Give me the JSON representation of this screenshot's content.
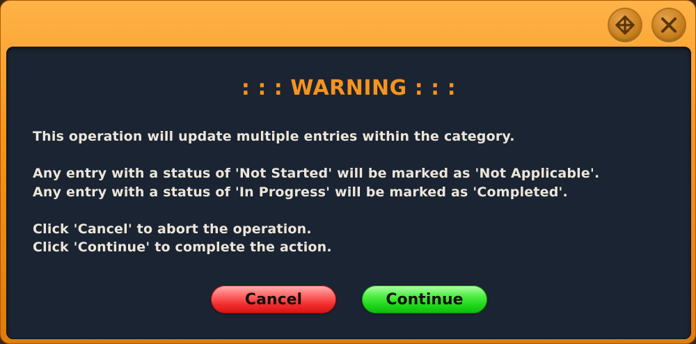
{
  "dialog": {
    "title_buttons": [
      {
        "icon": "move-icon"
      },
      {
        "icon": "close-icon"
      }
    ],
    "heading": ": : : WARNING : : :",
    "message_lines": [
      "This operation will update multiple entries within the category.",
      "Any entry with a status of 'Not Started' will be marked as 'Not Applicable'.",
      "Any entry with a status of 'In Progress' will be marked as 'Completed'.",
      "Click 'Cancel' to abort the operation.",
      "Click 'Continue' to complete the action."
    ],
    "buttons": {
      "cancel_label": "Cancel",
      "continue_label": "Continue"
    }
  },
  "colors": {
    "frame": "#f7931e",
    "panel": "#1b2432",
    "heading": "#f7931e",
    "text": "#ece6da",
    "cancel": "#f02a2a",
    "continue": "#1fd81a"
  }
}
